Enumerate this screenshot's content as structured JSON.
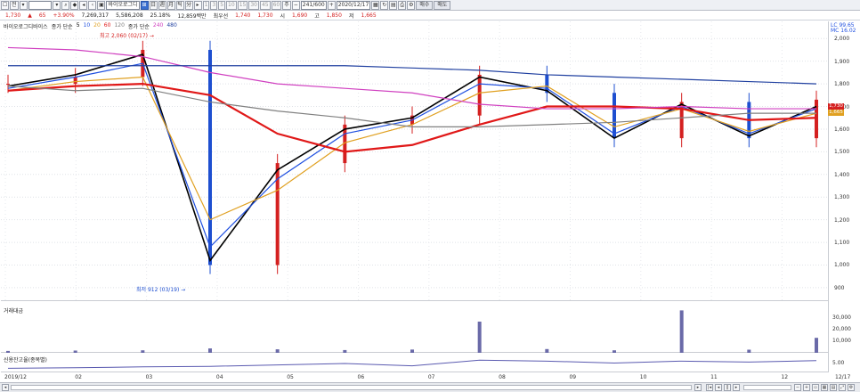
{
  "toolbar": {
    "mode_label": "전",
    "code": "009770",
    "name": "바이오로그디",
    "periods": [
      "1",
      "3",
      "5",
      "10",
      "15",
      "30",
      "45",
      "60",
      "주"
    ],
    "count": "241/600",
    "date": "2020/12/17",
    "buy_label": "매수",
    "sell_label": "매도"
  },
  "quote": {
    "price": "1,730",
    "change": "▲",
    "change_val": "65",
    "change_pct": "+3.90%",
    "volume": "7,269,317",
    "volume2": "5,586,208",
    "ratio": "25.18%",
    "amount": "12,859백만",
    "ma_label": "최우선",
    "ask": "1,740",
    "bid": "1,730",
    "open_label": "시",
    "open": "1,690",
    "high_label": "고",
    "high": "1,850",
    "low_label": "저",
    "low": "1,665"
  },
  "price_panel": {
    "legend": {
      "name": "바이오로그디바이스",
      "ma_label": "종가 단순",
      "ma_periods": [
        "5",
        "10",
        "20",
        "60",
        "120"
      ],
      "ma_colors": [
        "#000000",
        "#2050e0",
        "#e0a020",
        "#e01818",
        "#808080"
      ],
      "long_label": "종가 단순",
      "long_periods": [
        "240",
        "480"
      ],
      "long_colors": [
        "#d040c0",
        "#2040a0"
      ]
    },
    "high_note": "최고 2,060 (02/17) →",
    "low_note": "최저 912 (03/19) →",
    "corner_top": "LC 99.65",
    "corner_mc": "MC 16.02",
    "y_ticks": [
      "2,000",
      "1,900",
      "1,800",
      "1,700",
      "1,600",
      "1,500",
      "1,400",
      "1,300",
      "1,200",
      "1,100",
      "1,000",
      "900"
    ],
    "last_price": "1,730",
    "ref_price": "1,665"
  },
  "volume_panel": {
    "legend": "거래대금",
    "y_ticks": [
      "30,000",
      "20,000",
      "10,000"
    ]
  },
  "credit_panel": {
    "legend": "신용잔고율(종목별)",
    "y_ticks": [
      "5.00"
    ]
  },
  "x_axis": {
    "labels": [
      "2019/12",
      "02",
      "03",
      "04",
      "05",
      "06",
      "07",
      "08",
      "09",
      "10",
      "11",
      "12",
      "12/17"
    ]
  },
  "chart_data": {
    "type": "candlestick",
    "title": "바이오로그디바이스",
    "x": [
      "2019/12",
      "2020/01",
      "2020/02",
      "2020/03",
      "2020/04",
      "2020/05",
      "2020/06",
      "2020/07",
      "2020/08",
      "2020/09",
      "2020/10",
      "2020/11",
      "2020/12"
    ],
    "close": [
      1800,
      1830,
      1950,
      1000,
      1450,
      1620,
      1660,
      1840,
      1760,
      1560,
      1720,
      1560,
      1730
    ],
    "series": [
      {
        "name": "5",
        "values": [
          1790,
          1840,
          1930,
          1020,
          1420,
          1600,
          1650,
          1830,
          1770,
          1560,
          1710,
          1570,
          1700
        ]
      },
      {
        "name": "10",
        "values": [
          1780,
          1830,
          1890,
          1080,
          1380,
          1580,
          1640,
          1800,
          1780,
          1580,
          1700,
          1580,
          1690
        ]
      },
      {
        "name": "20",
        "values": [
          1770,
          1810,
          1830,
          1200,
          1330,
          1540,
          1620,
          1760,
          1790,
          1610,
          1690,
          1590,
          1670
        ]
      },
      {
        "name": "60",
        "values": [
          1770,
          1790,
          1800,
          1750,
          1580,
          1500,
          1530,
          1620,
          1700,
          1700,
          1690,
          1640,
          1650
        ]
      },
      {
        "name": "120",
        "values": [
          1790,
          1770,
          1780,
          1720,
          1680,
          1650,
          1610,
          1610,
          1620,
          1630,
          1650,
          1670,
          1670
        ]
      },
      {
        "name": "240",
        "values": [
          1960,
          1950,
          1920,
          1850,
          1800,
          1780,
          1760,
          1710,
          1690,
          1690,
          1700,
          1690,
          1690
        ]
      },
      {
        "name": "480",
        "values": [
          1880,
          1880,
          1880,
          1880,
          1880,
          1880,
          1870,
          1860,
          1840,
          1830,
          1820,
          1810,
          1800
        ]
      }
    ],
    "volume": [
      1500,
      1800,
      2000,
      3500,
      2800,
      2200,
      2600,
      25000,
      3000,
      2000,
      34000,
      2500,
      12000
    ],
    "credit_ratio": [
      3.5,
      3.6,
      3.8,
      3.9,
      4.2,
      4.5,
      4.0,
      5.2,
      5.0,
      4.6,
      5.0,
      4.8,
      5.1
    ],
    "ylim": [
      880,
      2060
    ],
    "ylabel": "",
    "xlabel": ""
  },
  "colors": {
    "up": "#d42020",
    "down": "#1e4fd0",
    "accent": "#3a6fd0"
  }
}
